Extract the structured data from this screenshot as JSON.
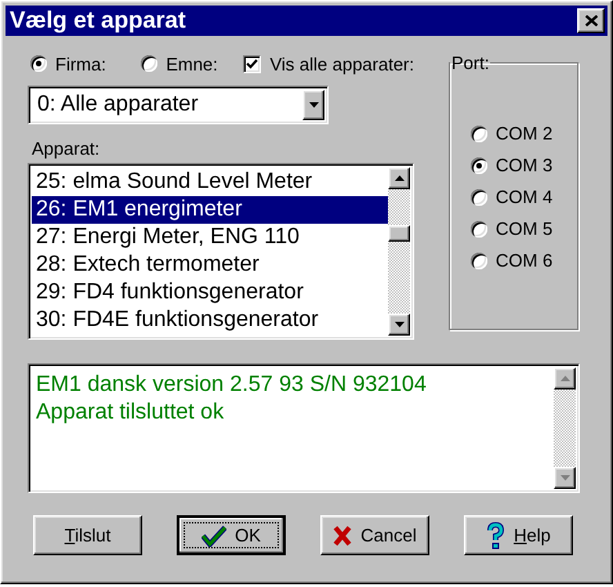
{
  "window": {
    "title": "Vælg et apparat"
  },
  "filter": {
    "options": [
      {
        "label": "Firma:",
        "selected": true
      },
      {
        "label": "Emne:",
        "selected": false
      }
    ],
    "show_all": {
      "label": "Vis alle apparater:",
      "checked": true
    }
  },
  "company_dropdown": {
    "value": "0: Alle apparater"
  },
  "device_list": {
    "label": "Apparat:",
    "items": [
      {
        "label": "25: elma Sound Level Meter",
        "selected": false
      },
      {
        "label": "26: EM1 energimeter",
        "selected": true
      },
      {
        "label": "27: Energi Meter, ENG 110",
        "selected": false
      },
      {
        "label": "28: Extech termometer",
        "selected": false
      },
      {
        "label": "29: FD4 funktionsgenerator",
        "selected": false
      },
      {
        "label": "30: FD4E funktionsgenerator",
        "selected": false
      }
    ]
  },
  "port": {
    "label": "Port:",
    "options": [
      {
        "label": "COM 2",
        "selected": false
      },
      {
        "label": "COM 3",
        "selected": true
      },
      {
        "label": "COM 4",
        "selected": false
      },
      {
        "label": "COM 5",
        "selected": false
      },
      {
        "label": "COM 6",
        "selected": false
      }
    ]
  },
  "messages": [
    "EM1 dansk version 2.57 93 S/N 932104",
    "Apparat tilsluttet ok"
  ],
  "buttons": [
    {
      "label": "Tilslut",
      "kind": "plain",
      "underline_first": true,
      "default": false
    },
    {
      "label": "OK",
      "kind": "ok",
      "default": true
    },
    {
      "label": "Cancel",
      "kind": "cancel",
      "default": false
    },
    {
      "label": "Help",
      "kind": "help",
      "underline_first": true,
      "default": false
    }
  ]
}
